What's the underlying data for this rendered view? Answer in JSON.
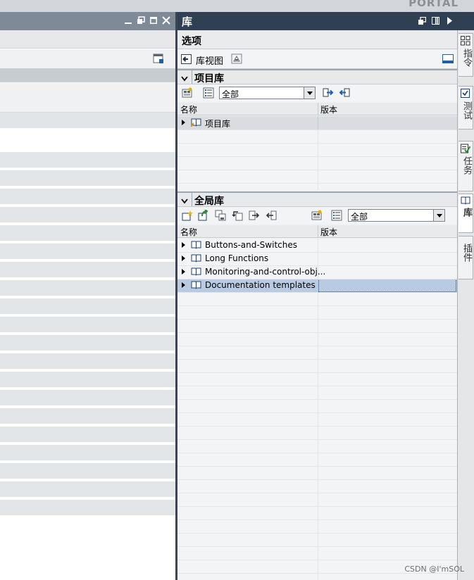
{
  "app": {
    "brand_suffix": "PORTAL"
  },
  "library_panel": {
    "title": "库",
    "options_label": "选项",
    "view_label": "库视图",
    "project_library": {
      "section_title": "项目库",
      "filter_value": "全部",
      "columns": {
        "name": "名称",
        "version": "版本"
      },
      "items": [
        {
          "label": "项目库",
          "version": ""
        }
      ]
    },
    "global_library": {
      "section_title": "全局库",
      "filter_value": "全部",
      "columns": {
        "name": "名称",
        "version": "版本"
      },
      "items": [
        {
          "label": "Buttons-and-Switches",
          "version": ""
        },
        {
          "label": "Long Functions",
          "version": ""
        },
        {
          "label": "Monitoring-and-control-obj...",
          "version": ""
        },
        {
          "label": "Documentation templates",
          "version": ""
        }
      ],
      "selected_index": 3
    }
  },
  "side_tabs": [
    {
      "label": "指令",
      "icon": "instructions-icon",
      "active": false
    },
    {
      "label": "测试",
      "icon": "testing-icon",
      "active": false
    },
    {
      "label": "任务",
      "icon": "tasks-icon",
      "active": false
    },
    {
      "label": "库",
      "icon": "library-book-icon",
      "active": true
    },
    {
      "label": "插件",
      "icon": "addins-icon",
      "active": false
    }
  ],
  "watermark": "CSDN @I'mSOL",
  "colors": {
    "title_bar": "#2f3f54",
    "selection": "#b9cbe3",
    "accent": "#1f5fa8"
  }
}
